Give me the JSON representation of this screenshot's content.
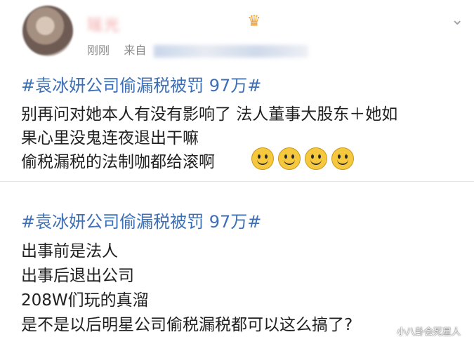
{
  "post1": {
    "username": "瑶光",
    "meta_time": "刚刚",
    "meta_source_prefix": "来自",
    "hashtag": "#袁冰妍公司偷漏税被罚 97万#",
    "lines": [
      "别再问对她本人有没有影响了 法人董事大股东＋她如",
      "果心里没鬼连夜退出干嘛",
      "偷税漏税的法制咖都给滚啊"
    ],
    "emoji_icons": [
      "smile-emoji",
      "smile-emoji",
      "smile-emoji",
      "smile-emoji"
    ]
  },
  "post2": {
    "hashtag": "#袁冰妍公司偷漏税被罚 97万#",
    "lines": [
      "出事前是法人",
      "出事后退出公司",
      "208W们玩的真溜",
      "是不是以后明星公司偷税漏税都可以这么搞了?"
    ]
  },
  "watermark": "小八卦会死星人"
}
